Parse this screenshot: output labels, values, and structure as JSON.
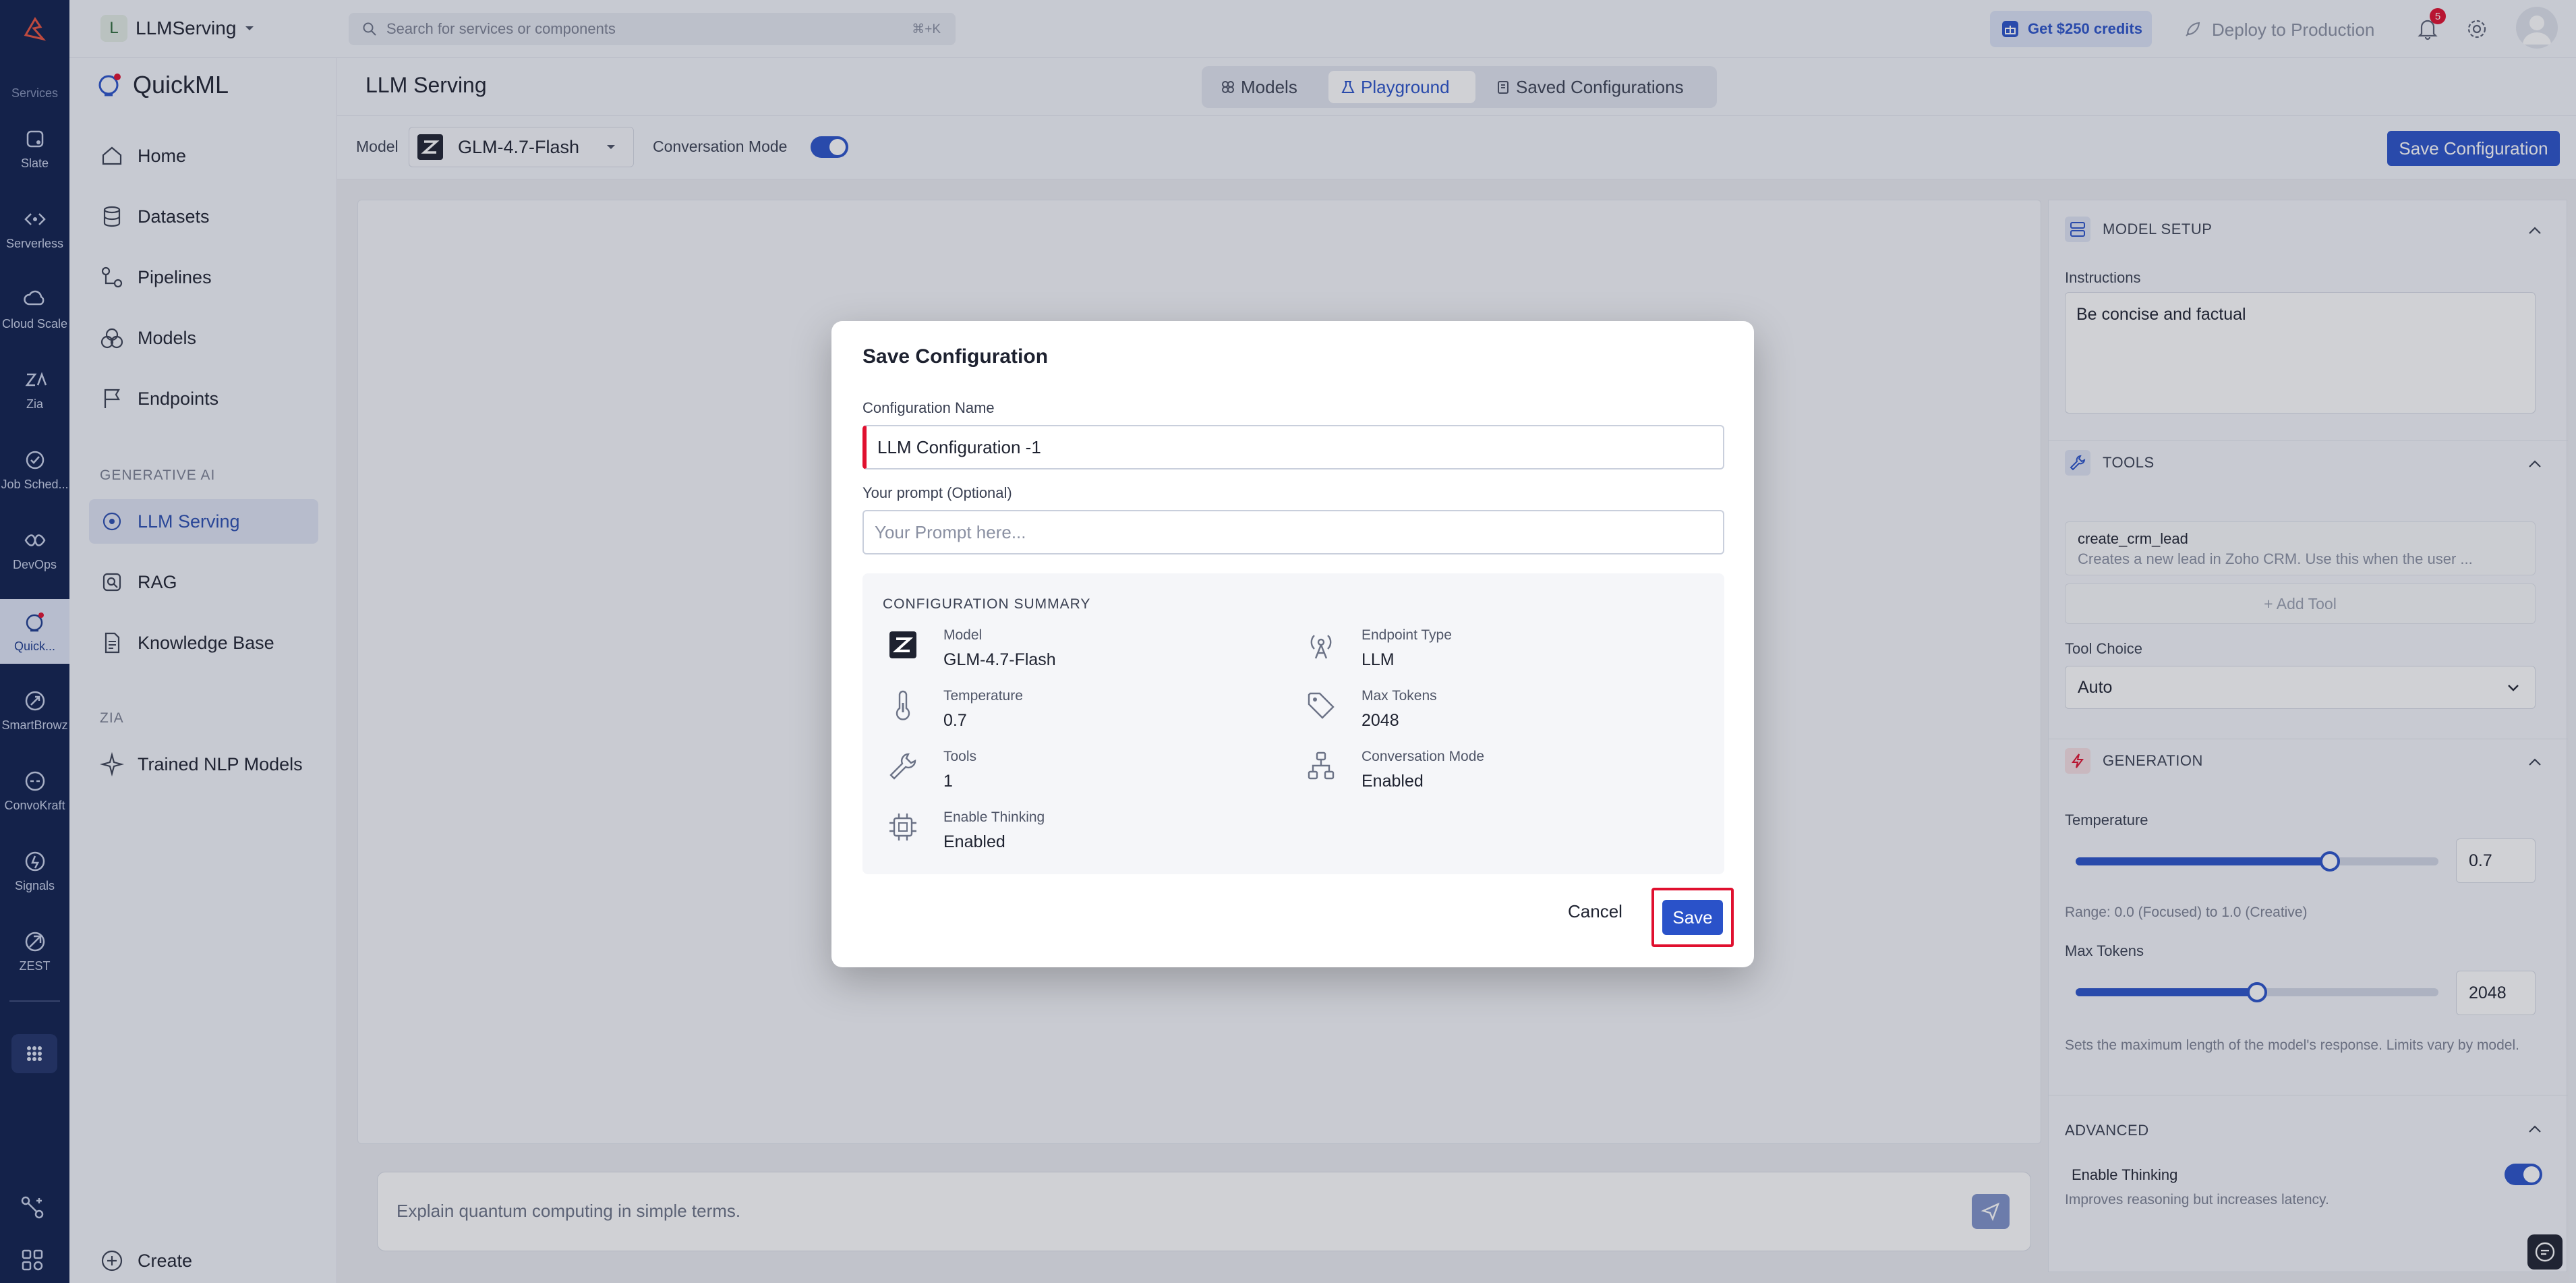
{
  "rail": {
    "services_label": "Services",
    "items": [
      {
        "label": "Slate",
        "icon": "slate-icon"
      },
      {
        "label": "Serverless",
        "icon": "serverless-icon"
      },
      {
        "label": "Cloud Scale",
        "icon": "cloud-scale-icon"
      },
      {
        "label": "Zia",
        "icon": "zia-icon"
      },
      {
        "label": "Job Sched...",
        "icon": "job-scheduler-icon"
      },
      {
        "label": "DevOps",
        "icon": "devops-icon"
      },
      {
        "label": "Quick...",
        "icon": "quickml-icon"
      },
      {
        "label": "SmartBrowz",
        "icon": "smartbrowz-icon"
      },
      {
        "label": "ConvoKraft",
        "icon": "convokraft-icon"
      },
      {
        "label": "Signals",
        "icon": "signals-icon"
      },
      {
        "label": "ZEST",
        "icon": "zest-icon"
      }
    ]
  },
  "topbar": {
    "project_initial": "L",
    "project_name": "LLMServing",
    "search_placeholder": "Search for services or components",
    "search_shortcut": "⌘+K",
    "credits_label": "Get $250 credits",
    "deploy_label": "Deploy to Production",
    "notification_count": "5"
  },
  "sidebar": {
    "app_name": "QuickML",
    "items": [
      {
        "label": "Home"
      },
      {
        "label": "Datasets"
      },
      {
        "label": "Pipelines"
      },
      {
        "label": "Models"
      },
      {
        "label": "Endpoints"
      }
    ],
    "section_genai": "GENERATIVE AI",
    "genai_items": [
      {
        "label": "LLM Serving"
      },
      {
        "label": "RAG"
      },
      {
        "label": "Knowledge Base"
      }
    ],
    "section_zia": "ZIA",
    "zia_items": [
      {
        "label": "Trained NLP Models"
      }
    ],
    "create_label": "Create"
  },
  "header": {
    "title": "LLM Serving",
    "tabs": [
      {
        "label": "Models"
      },
      {
        "label": "Playground"
      },
      {
        "label": "Saved Configurations"
      }
    ]
  },
  "modelbar": {
    "model_label": "Model",
    "model_value": "GLM-4.7-Flash",
    "conversation_mode_label": "Conversation Mode",
    "save_config_label": "Save Configuration"
  },
  "chat": {
    "input_placeholder": "Explain quantum computing in simple terms."
  },
  "panel": {
    "model_setup_title": "MODEL SETUP",
    "instructions_label": "Instructions",
    "instructions_value": "Be concise and factual",
    "tools_title": "TOOLS",
    "tool_name": "create_crm_lead",
    "tool_desc": "Creates a new lead in Zoho CRM. Use this when the user ...",
    "add_tool_label": "+ Add Tool",
    "tool_choice_label": "Tool Choice",
    "tool_choice_value": "Auto",
    "generation_title": "GENERATION",
    "temperature_label": "Temperature",
    "temperature_value": "0.7",
    "temperature_fraction": 0.7,
    "temperature_range": "Range: 0.0 (Focused) to 1.0 (Creative)",
    "max_tokens_label": "Max Tokens",
    "max_tokens_value": "2048",
    "max_tokens_fraction": 0.5,
    "max_tokens_help": "Sets the maximum length of the model's response. Limits vary by model.",
    "advanced_title": "ADVANCED",
    "enable_thinking_label": "Enable Thinking",
    "enable_thinking_help": "Improves reasoning but increases latency."
  },
  "modal": {
    "title": "Save Configuration",
    "config_name_label": "Configuration Name",
    "config_name_value": "LLM Configuration -1",
    "prompt_label": "Your prompt (Optional)",
    "prompt_placeholder": "Your Prompt here...",
    "summary_title": "CONFIGURATION SUMMARY",
    "summary": {
      "model_label": "Model",
      "model_value": "GLM-4.7-Flash",
      "endpoint_label": "Endpoint Type",
      "endpoint_value": "LLM",
      "temperature_label": "Temperature",
      "temperature_value": "0.7",
      "max_tokens_label": "Max Tokens",
      "max_tokens_value": "2048",
      "tools_label": "Tools",
      "tools_value": "1",
      "conversation_label": "Conversation Mode",
      "conversation_value": "Enabled",
      "thinking_label": "Enable Thinking",
      "thinking_value": "Enabled"
    },
    "cancel_label": "Cancel",
    "save_label": "Save"
  },
  "colors": {
    "rail_bg": "#0f1f4d",
    "accent": "#2a52c9",
    "highlight_border": "#e0102f"
  }
}
